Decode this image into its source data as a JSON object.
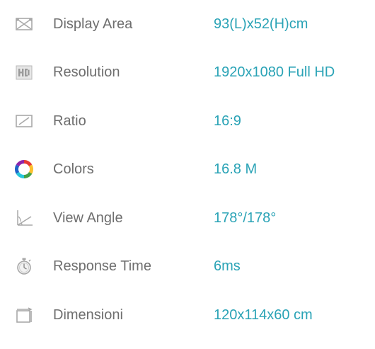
{
  "colors": {
    "label": "#6e6e6e",
    "value": "#2aa3b6",
    "icon": "#a8a8a8"
  },
  "specs": [
    {
      "icon": "display-area-icon",
      "label": "Display Area",
      "value": "93(L)x52(H)cm"
    },
    {
      "icon": "hd-icon",
      "label": "Resolution",
      "value": "1920x1080 Full HD"
    },
    {
      "icon": "ratio-icon",
      "label": "Ratio",
      "value": "16:9"
    },
    {
      "icon": "color-wheel-icon",
      "label": "Colors",
      "value": "16.8 M"
    },
    {
      "icon": "view-angle-icon",
      "label": "View Angle",
      "value": "178°/178°"
    },
    {
      "icon": "stopwatch-icon",
      "label": "Response Time",
      "value": "6ms"
    },
    {
      "icon": "dimensions-icon",
      "label": "Dimensioni",
      "value": "120x114x60 cm"
    }
  ]
}
